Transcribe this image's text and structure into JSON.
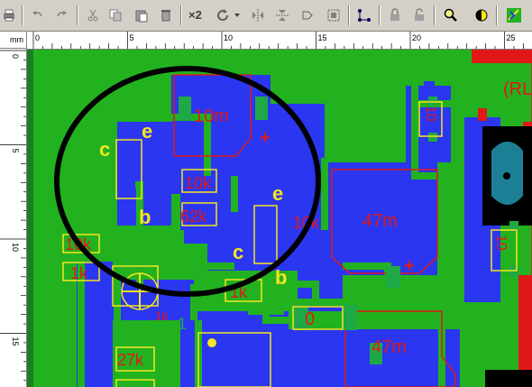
{
  "toolbar": {
    "multiply_label": "×2",
    "buttons": [
      "print-icon",
      "undo-icon",
      "redo-icon",
      "cut-icon",
      "copy-icon",
      "paste-icon",
      "delete-icon",
      "duplicate-icon",
      "rotate-icon",
      "rotate-dropdown-icon",
      "mirror-h-icon",
      "mirror-v-icon",
      "flip-icon",
      "group-icon",
      "connection-icon",
      "lock-icon",
      "unlock-icon",
      "zoom-icon",
      "contrast-icon",
      "drc-icon"
    ]
  },
  "ruler": {
    "unit": "mm",
    "h_labels": [
      "0",
      "5",
      "10",
      "15",
      "20",
      "25"
    ],
    "v_labels": [
      "0",
      "5",
      "10",
      "15"
    ]
  },
  "pcb": {
    "colors": {
      "background": "#22b21f",
      "copper_bottom": "#2b36f0",
      "silkscreen_red": "#e01818",
      "silkscreen_yellow": "#f5e61e",
      "highlight_circle": "#000000",
      "pad": "#1fa846",
      "black_region": "#000000",
      "teal_pad": "#1d7f96"
    },
    "components": {
      "r_10m": "10m",
      "r_10k_a": "10k",
      "r_62k": "62k",
      "r_10k_b": "10k",
      "c_47m_a": "47m",
      "c_47m_b": "47m",
      "r_10k_c": "10k",
      "r_1k_a": "1k",
      "r_1k_b": "1k",
      "r_1k_c": "1k",
      "r_27k": "27k",
      "c_0": "0",
      "c_10_vertical_top": "10",
      "c_10_vertical_right": "10",
      "led_rl": "(RL",
      "one": "1"
    },
    "transistor_pins": {
      "e1": "e",
      "c1": "c",
      "b1": "b",
      "e2": "e",
      "c2": "c",
      "b2": "b"
    },
    "polarity_plus": "+"
  }
}
